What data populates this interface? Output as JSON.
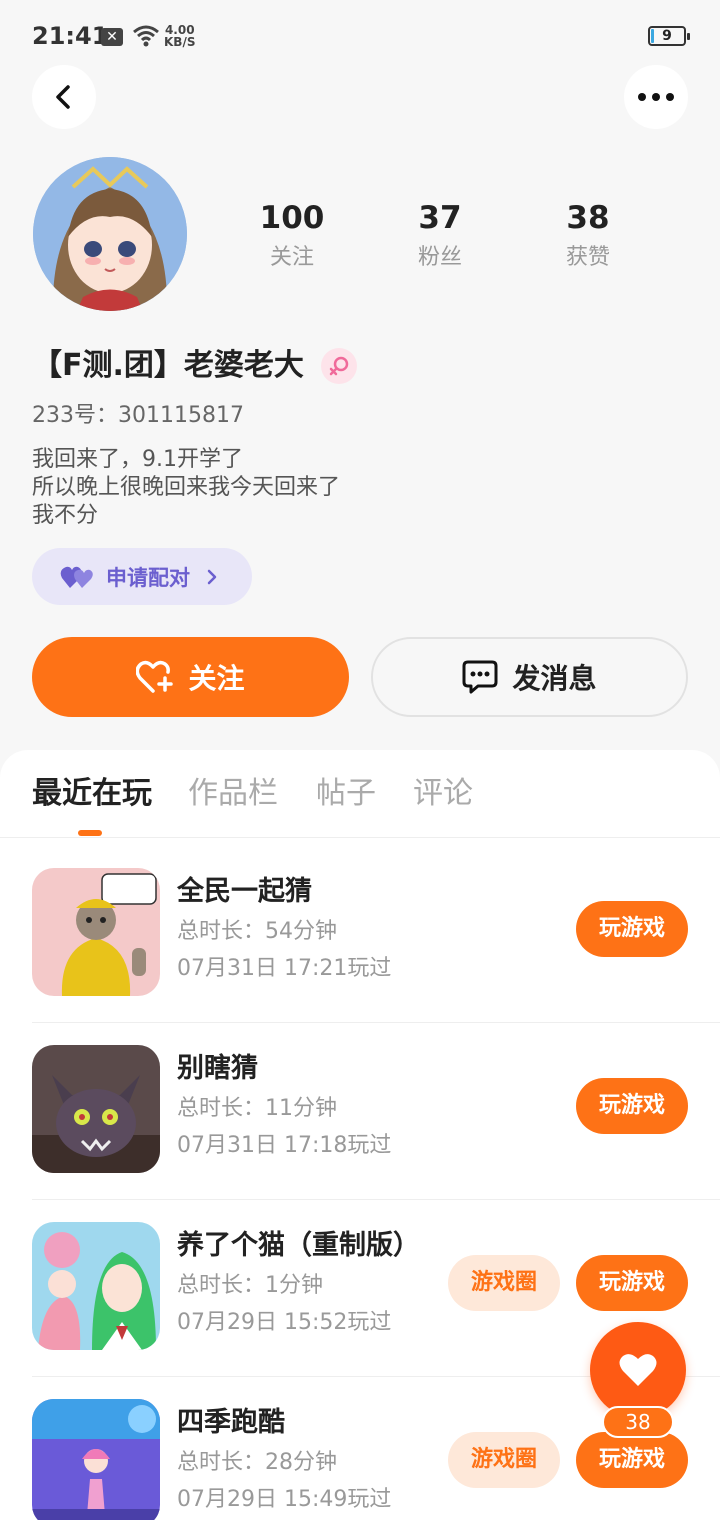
{
  "status_bar": {
    "time": "21:41",
    "speed_value": "4.00",
    "speed_unit": "KB/S",
    "battery": "9",
    "battery_level": 0.09
  },
  "header": {
    "back_icon": "chevron-left-icon",
    "more_icon": "more-dots-icon"
  },
  "profile": {
    "stats": [
      {
        "value": "100",
        "label": "关注"
      },
      {
        "value": "37",
        "label": "粉丝"
      },
      {
        "value": "38",
        "label": "获赞"
      }
    ],
    "username": "【F测.团】老婆老大",
    "gender_icon": "female-icon",
    "uid": "233号：301115817",
    "bio_lines": [
      "我回来了，9.1开学了",
      "所以晚上很晚回来我今天回来了",
      "我不分"
    ],
    "pair_label": "申请配对",
    "follow_label": "关注",
    "message_label": "发消息",
    "colors": {
      "accent": "#fe7216",
      "pair": "#6b5fcf"
    }
  },
  "tabs": [
    {
      "label": "最近在玩",
      "active": true
    },
    {
      "label": "作品栏",
      "active": false
    },
    {
      "label": "帖子",
      "active": false
    },
    {
      "label": "评论",
      "active": false
    }
  ],
  "games": [
    {
      "title": "全民一起猜",
      "duration": "总时长：54分钟",
      "played": "07月31日 17:21玩过",
      "play_label": "玩游戏",
      "circle_label": ""
    },
    {
      "title": "别瞎猜",
      "duration": "总时长：11分钟",
      "played": "07月31日 17:18玩过",
      "play_label": "玩游戏",
      "circle_label": ""
    },
    {
      "title": "养了个猫（重制版）",
      "duration": "总时长：1分钟",
      "played": "07月29日 15:52玩过",
      "play_label": "玩游戏",
      "circle_label": "游戏圈"
    },
    {
      "title": "四季跑酷",
      "duration": "总时长：28分钟",
      "played": "07月29日 15:49玩过",
      "play_label": "玩游戏",
      "circle_label": "游戏圈"
    }
  ],
  "like_fab": {
    "count": "38",
    "icon": "heart-icon"
  }
}
